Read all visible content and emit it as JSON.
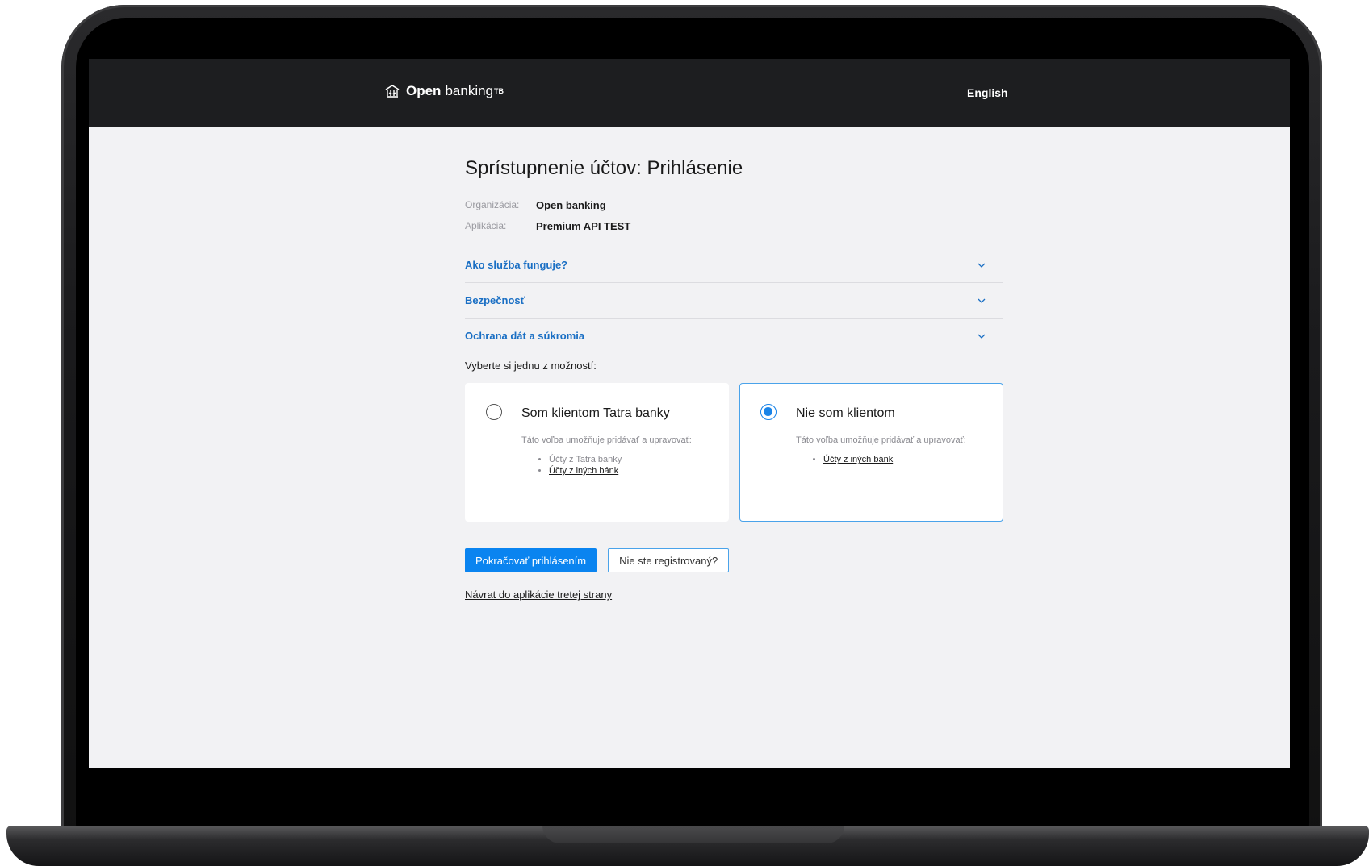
{
  "header": {
    "logo_strong": "Open",
    "logo_light": "banking",
    "logo_sup": "TB",
    "language": "English"
  },
  "page": {
    "title": "Sprístupnenie účtov: Prihlásenie",
    "meta": [
      {
        "label": "Organizácia:",
        "value": "Open banking"
      },
      {
        "label": "Aplikácia:",
        "value": "Premium API TEST"
      }
    ],
    "accordion": [
      {
        "label": "Ako služba funguje?"
      },
      {
        "label": "Bezpečnosť"
      },
      {
        "label": "Ochrana dát a súkromia"
      }
    ],
    "choose_label": "Vyberte si jednu z možností:",
    "options": [
      {
        "title": "Som klientom Tatra banky",
        "description": "Táto voľba umožňuje pridávať a upravovať:",
        "items": [
          "Účty z Tatra banky",
          "Účty z iných bánk"
        ],
        "selected": false
      },
      {
        "title": "Nie som klientom",
        "description": "Táto voľba umožňuje pridávať a upravovať:",
        "items": [
          "Účty z iných bánk"
        ],
        "selected": true
      }
    ],
    "primary_button": "Pokračovať prihlásením",
    "secondary_button": "Nie ste registrovaný?",
    "back_link": "Návrat do aplikácie tretej strany"
  },
  "colors": {
    "accent": "#0a84f0",
    "link": "#1a6fc4",
    "topbar": "#1d1e20",
    "background": "#f2f2f4"
  }
}
